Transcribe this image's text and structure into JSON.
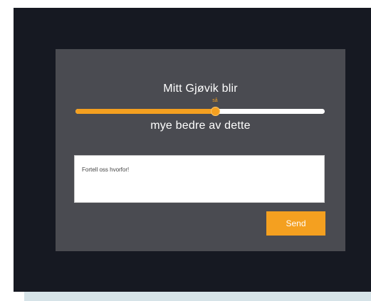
{
  "survey": {
    "title": "Mitt Gjøvik blir",
    "subtitle": "mye bedre av dette",
    "slider": {
      "value_label": "så",
      "value_fraction": 0.56
    },
    "comment": {
      "value": "",
      "placeholder": "Fortell oss hvorfor!"
    },
    "send_label": "Send"
  },
  "colors": {
    "background": "#161922",
    "card": "#4a4b51",
    "accent": "#f4a020",
    "track": "#ffffff"
  }
}
